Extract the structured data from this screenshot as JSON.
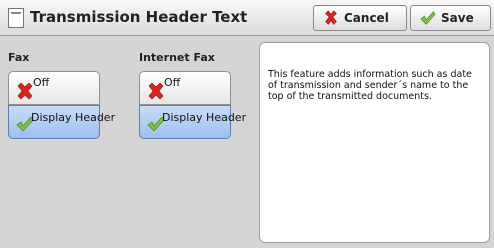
{
  "header": {
    "title": "Transmission Header Text",
    "cancel_label": "Cancel",
    "save_label": "Save",
    "cancel_icon": "x-icon",
    "save_icon": "check-icon"
  },
  "fax": {
    "label": "Fax",
    "options": [
      {
        "label": "Off",
        "icon": "x-icon",
        "selected": false
      },
      {
        "label": "Display Header",
        "icon": "check-icon",
        "selected": true
      }
    ]
  },
  "internet_fax": {
    "label": "Internet Fax",
    "options": [
      {
        "label": "Off",
        "icon": "x-icon",
        "selected": false
      },
      {
        "label": "Display Header",
        "icon": "check-icon",
        "selected": true
      }
    ]
  },
  "info": {
    "text": "This feature adds information such as date of transmission and sender´s name to the top of the transmitted documents."
  },
  "colors": {
    "selected_bg": "#a9c8f2",
    "cross_red": "#d8261c",
    "check_green": "#7cc242"
  }
}
